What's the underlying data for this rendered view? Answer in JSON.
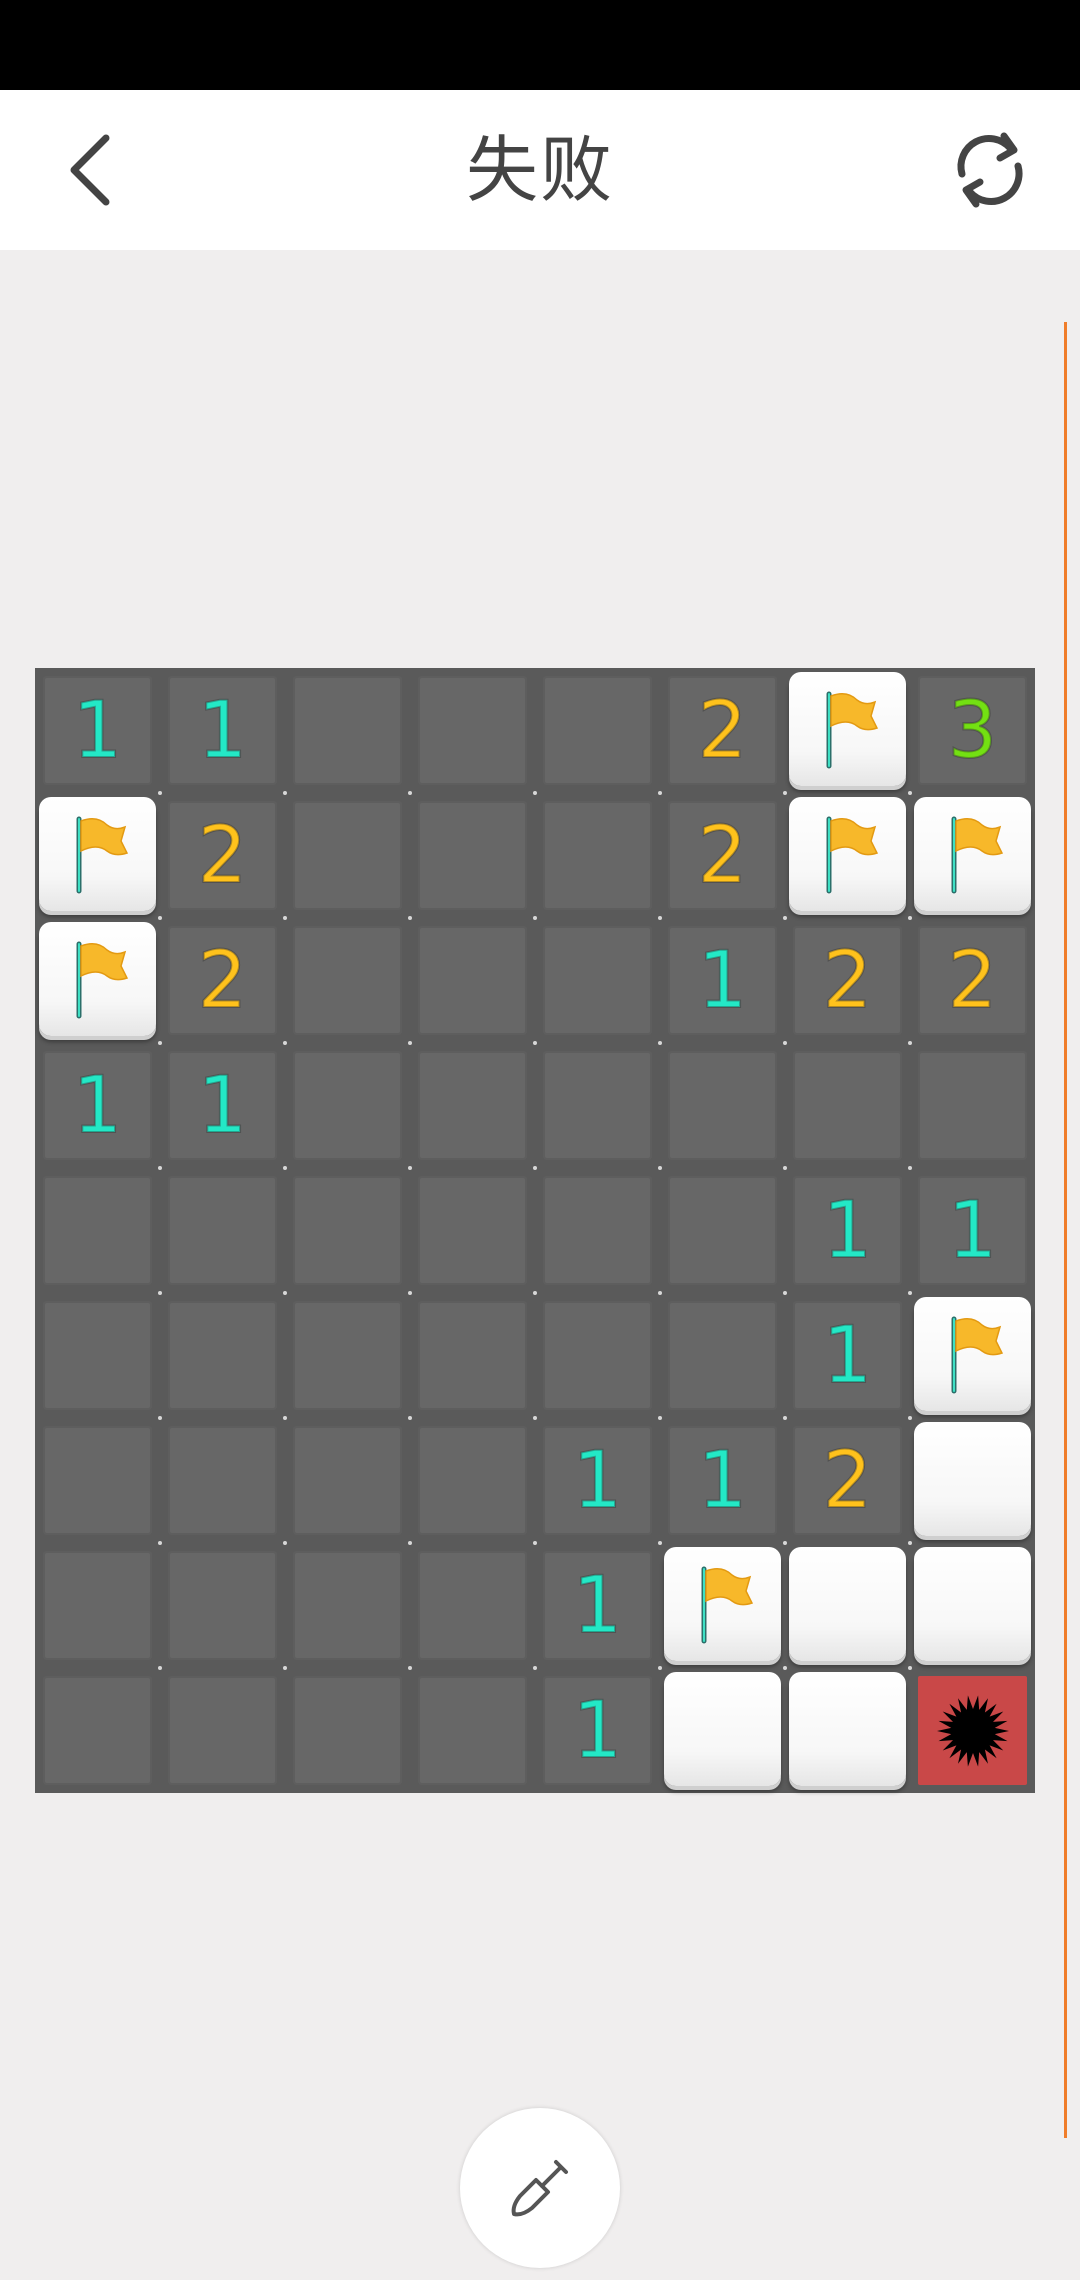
{
  "header": {
    "title": "失败",
    "back_icon": "chevron-left-icon",
    "restart_icon": "refresh-icon"
  },
  "colors": {
    "one": "#23e8c6",
    "two": "#ffc21c",
    "three": "#73e012",
    "flag": "#f7b82a",
    "mine_bg": "#c94848",
    "accent_line": "#f07d2a"
  },
  "board": {
    "rows": 9,
    "cols": 8,
    "status": "lost",
    "grid": [
      [
        "1",
        "1",
        "0",
        "0",
        "0",
        "2",
        "F",
        "3"
      ],
      [
        "F",
        "2",
        "0",
        "0",
        "0",
        "2",
        "F",
        "F"
      ],
      [
        "F",
        "2",
        "0",
        "0",
        "0",
        "1",
        "2",
        "2"
      ],
      [
        "1",
        "1",
        "0",
        "0",
        "0",
        "0",
        "0",
        "0"
      ],
      [
        "0",
        "0",
        "0",
        "0",
        "0",
        "0",
        "1",
        "1"
      ],
      [
        "0",
        "0",
        "0",
        "0",
        "0",
        "0",
        "1",
        "F"
      ],
      [
        "0",
        "0",
        "0",
        "0",
        "1",
        "1",
        "2",
        "H"
      ],
      [
        "0",
        "0",
        "0",
        "0",
        "1",
        "F",
        "H",
        "H"
      ],
      [
        "0",
        "0",
        "0",
        "0",
        "1",
        "H",
        "H",
        "M"
      ]
    ]
  },
  "tool": {
    "icon": "shovel-icon"
  }
}
